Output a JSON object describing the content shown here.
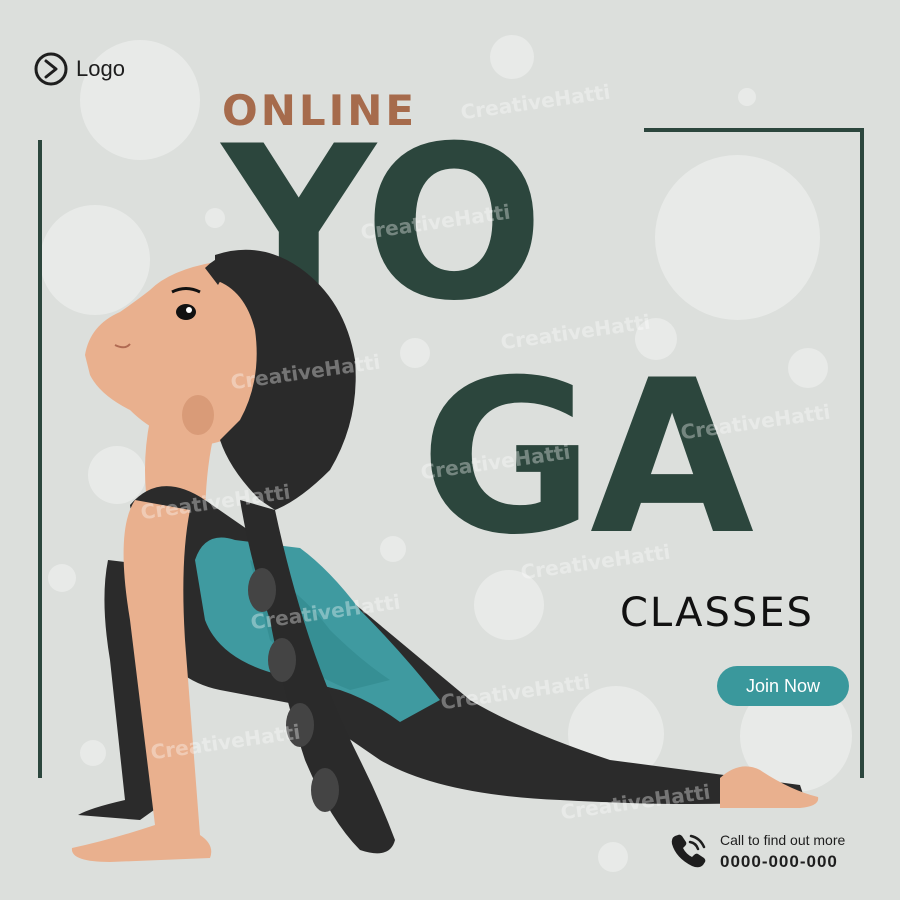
{
  "logo": {
    "label": "Logo",
    "icon": "play-circle-icon"
  },
  "headline": {
    "online": "ONLINE",
    "yo": "YO",
    "ga": "GA",
    "classes": "CLASSES"
  },
  "cta": {
    "join_label": "Join Now"
  },
  "contact": {
    "label": "Call to find out more",
    "phone": "0000-000-000",
    "icon": "phone-icon"
  },
  "watermark": "CreativeHatti",
  "colors": {
    "background": "#dcdfdc",
    "primary_dark_green": "#2c463d",
    "accent_brown": "#a66b4c",
    "button_teal": "#3a989c",
    "skin": "#e9b08e",
    "hair": "#2a2a2a",
    "suit_dark": "#2b2b2b",
    "suit_teal": "#3f9aa0"
  }
}
